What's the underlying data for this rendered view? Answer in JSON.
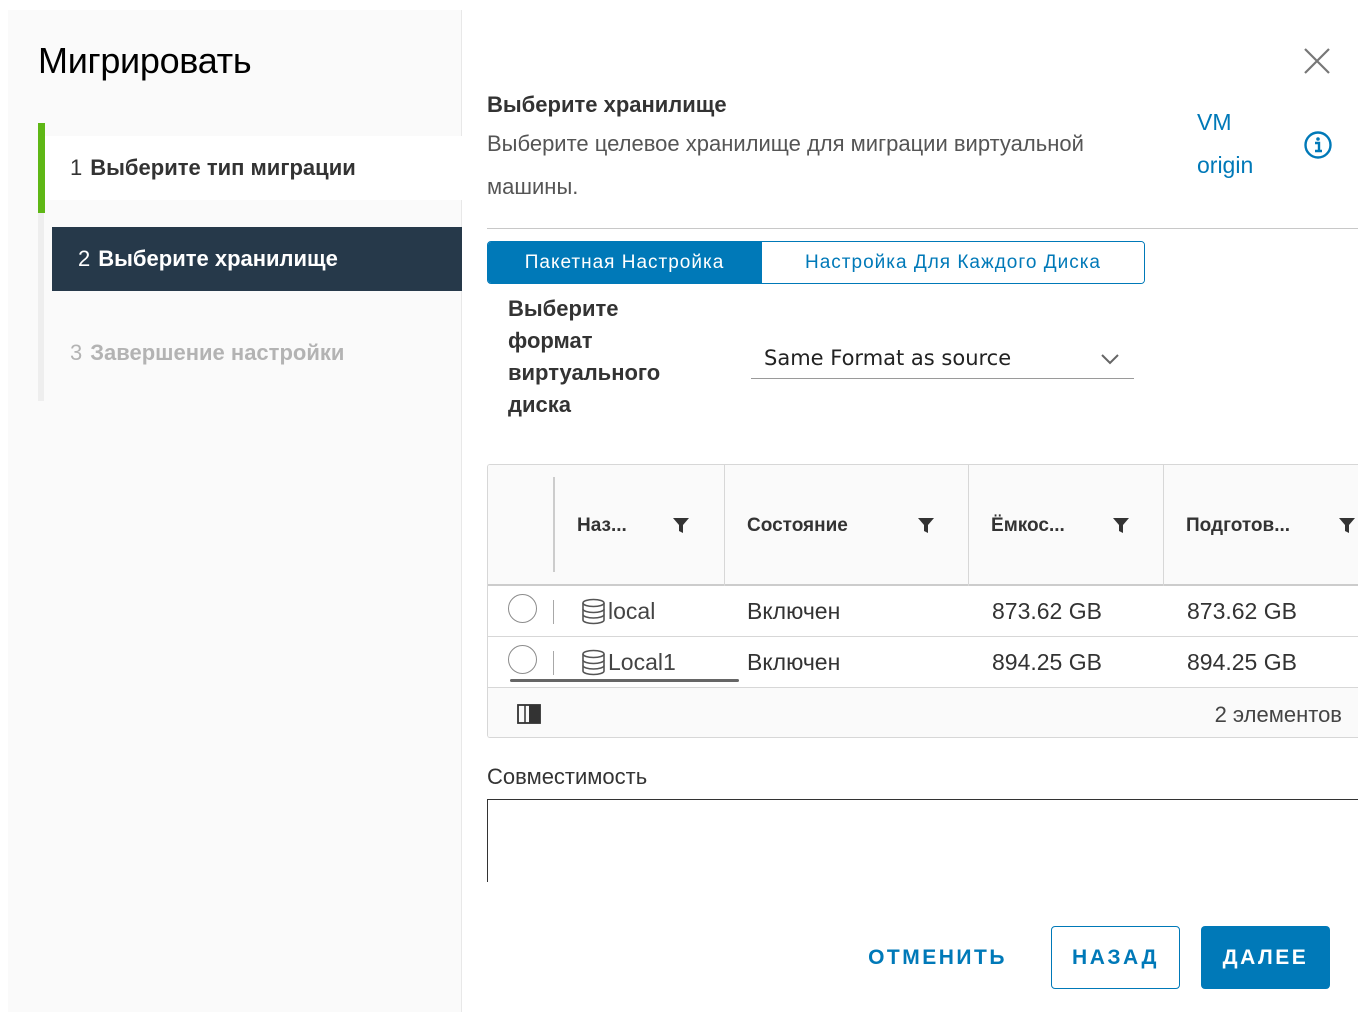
{
  "wizard": {
    "title": "Мигрировать",
    "steps": [
      {
        "num": "1",
        "label": "Выберите тип миграции",
        "state": "completed"
      },
      {
        "num": "2",
        "label": "Выберите хранилище",
        "state": "active"
      },
      {
        "num": "3",
        "label": "Завершение настройки",
        "state": "disabled"
      }
    ]
  },
  "page": {
    "title": "Выберите хранилище",
    "description": "Выберите целевое хранилище для миграции виртуальной машины.",
    "vm_origin_link": "VM origin",
    "close_icon": "close-icon",
    "info_icon": "info-icon"
  },
  "tabs": [
    {
      "label": "Пакетная Настройка",
      "active": true
    },
    {
      "label": "Настройка Для Каждого Диска",
      "active": false
    }
  ],
  "disk_format": {
    "label": "Выберите формат виртуального диска",
    "value": "Same Format as source"
  },
  "grid": {
    "columns": [
      "Наз...",
      "Состояние",
      "Ёмкос...",
      "Подготов..."
    ],
    "rows": [
      {
        "name": "local",
        "state": "Включен",
        "capacity": "873.62 GB",
        "provisioned": "873.62 GB"
      },
      {
        "name": "Local1",
        "state": "Включен",
        "capacity": "894.25 GB",
        "provisioned": "894.25 GB"
      }
    ],
    "footer_count": "2 элементов"
  },
  "compatibility": {
    "label": "Совместимость"
  },
  "buttons": {
    "cancel": "ОТМЕНИТЬ",
    "back": "НАЗАД",
    "next": "ДАЛЕЕ"
  },
  "colors": {
    "accent": "#0079b8",
    "active_step_bg": "#26394a",
    "completed_step_marker": "#5eb715"
  }
}
